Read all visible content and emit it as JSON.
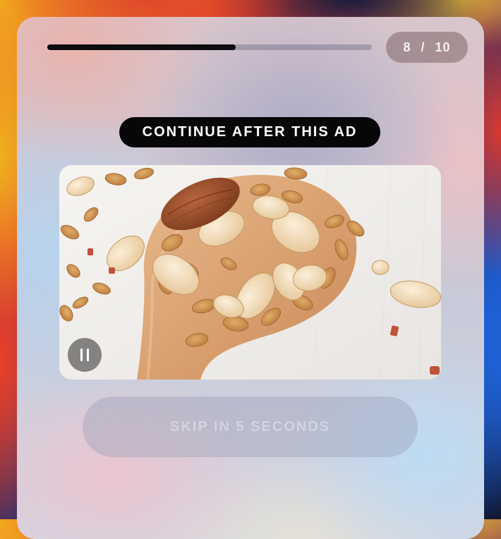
{
  "progress": {
    "current": 8,
    "total": 10,
    "fraction": 0.58
  },
  "counter": {
    "current": "8",
    "separator": "/",
    "total": "10"
  },
  "ad_badge": {
    "label": "CONTINUE AFTER THIS AD"
  },
  "media": {
    "subject": "nuts-on-wooden-spoon",
    "pause_icon": "pause-icon",
    "state": "playing"
  },
  "skip": {
    "label": "SKIP IN 5 SECONDS",
    "enabled": false
  },
  "colors": {
    "progress_fill": "#0c0c0e",
    "badge_background": "#07070a",
    "badge_text": "#ffffff"
  }
}
